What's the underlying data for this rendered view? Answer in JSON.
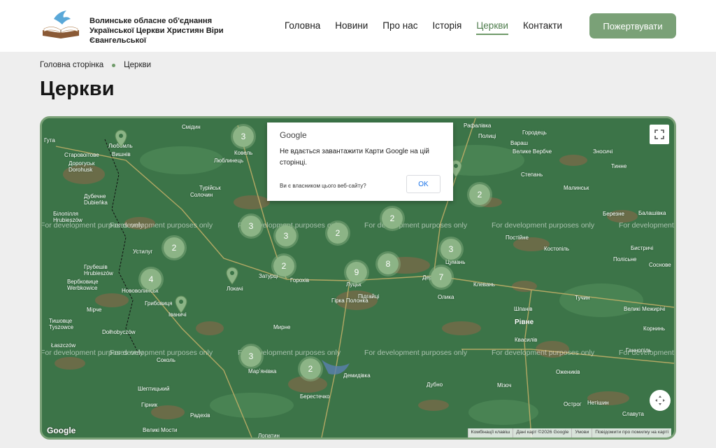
{
  "header": {
    "org_name": "Волинське обласне об'єднання Української Церкви Християн Віри Євангельської",
    "nav": [
      "Головна",
      "Новини",
      "Про нас",
      "Історія",
      "Церкви",
      "Контакти"
    ],
    "active_nav": "Церкви",
    "donate_label": "Пожертвувати",
    "accent_color": "#7aa177"
  },
  "breadcrumb": {
    "home": "Головна сторінка",
    "current": "Церкви"
  },
  "page_title": "Церкви",
  "map": {
    "watermark": "For development purposes only",
    "dialog": {
      "logo": "Google",
      "message": "Не вдається завантажити Карти Google на цій сторінці.",
      "owner_link": "Ви є власником цього веб-сайту?",
      "ok": "OK"
    },
    "google_logo": "Google",
    "attribution": [
      "Комбінації клавіш",
      "Дані карт ©2026 Google",
      "Умови",
      "Повідомити про помилку на карті"
    ],
    "clusters": [
      "3",
      "2",
      "3",
      "3",
      "2",
      "2",
      "2",
      "3",
      "2",
      "2",
      "4",
      "9",
      "8",
      "7",
      "3",
      "2"
    ],
    "places": [
      "Гута",
      "Вишнів",
      "Старовоітове",
      "Дорогуськ",
      "Dorohusk",
      "Смідин",
      "Ковель",
      "Любомль",
      "Люблинець",
      "Турійськ",
      "Солочин",
      "Дубечне",
      "Dubieńka",
      "Білопілля",
      "Hrubieszów",
      "Устилуг",
      "Грубешів",
      "Hrubieszów",
      "Вербковице",
      "Werbkowice",
      "Нововолинськ",
      "Іваничі",
      "Грибовиця",
      "Мірче",
      "Тишовце",
      "Tyszowce",
      "Dołhobyczów",
      "Локачі",
      "Затурці",
      "Горохів",
      "Луцьк",
      "Підгайці",
      "Гірка Полонка",
      "Мирне",
      "Рафалівка",
      "Полиці",
      "Городець",
      "Вараш",
      "Велике Вербче",
      "Степань",
      "Малинськ",
      "Зносичі",
      "Тинне",
      "Березне",
      "Балашівка",
      "Постійне",
      "Костопіль",
      "Бистричі",
      "Цумань",
      "Деражне",
      "Олика",
      "Клевань",
      "Тучин",
      "Полісьне",
      "Соснове",
      "Рівне",
      "Шпанів",
      "Великі Межирічі",
      "Корнинь",
      "Квасилів",
      "Ожеників",
      "Ганнопіль",
      "Мізоч",
      "Острог",
      "Нетішин",
      "Славута",
      "Дубно",
      "Демидівка",
      "Берестечко",
      "Шептицький",
      "Марʼянівка",
      "Соколь",
      "Łaszczów",
      "Гірник",
      "Великі Мости",
      "Радехів",
      "Лопатин"
    ],
    "colors": {
      "forest": "#3c7448",
      "field": "#7a6a48",
      "road": "#c8b26a",
      "cluster": "#8cb486"
    }
  }
}
